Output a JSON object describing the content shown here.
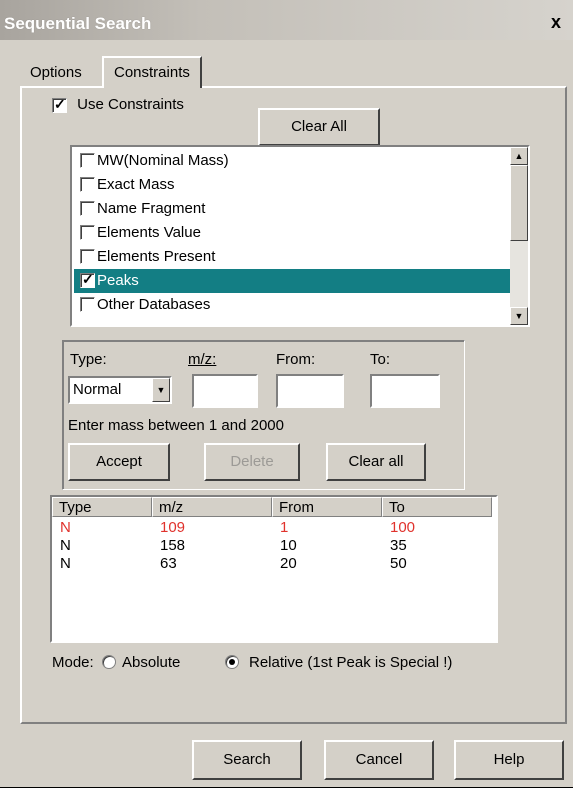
{
  "window": {
    "title": "Sequential Search",
    "close_label": "x"
  },
  "tabs": {
    "options": "Options",
    "constraints": "Constraints"
  },
  "use_constraints": {
    "label": "Use Constraints",
    "checked": true
  },
  "clear_all_top": "Clear All",
  "constraint_list": [
    {
      "label": "MW(Nominal Mass)",
      "checked": false,
      "selected": false
    },
    {
      "label": "Exact Mass",
      "checked": false,
      "selected": false
    },
    {
      "label": "Name Fragment",
      "checked": false,
      "selected": false
    },
    {
      "label": "Elements Value",
      "checked": false,
      "selected": false
    },
    {
      "label": "Elements Present",
      "checked": false,
      "selected": false
    },
    {
      "label": "Peaks",
      "checked": true,
      "selected": true
    },
    {
      "label": "Other Databases",
      "checked": false,
      "selected": false
    }
  ],
  "peak_form": {
    "type_label": "Type:",
    "mz_label": "m/z:",
    "from_label": "From:",
    "to_label": "To:",
    "type_value": "Normal",
    "mz_value": "",
    "from_value": "",
    "to_value": "",
    "hint": "Enter mass between 1 and 2000",
    "accept": "Accept",
    "delete": "Delete",
    "clear_all": "Clear all"
  },
  "peaks_table": {
    "columns": [
      "Type",
      "m/z",
      "From",
      "To"
    ],
    "rows": [
      {
        "type": "N",
        "mz": "109",
        "from": "1",
        "to": "100",
        "highlight": true
      },
      {
        "type": "N",
        "mz": "158",
        "from": "10",
        "to": "35",
        "highlight": false
      },
      {
        "type": "N",
        "mz": "63",
        "from": "20",
        "to": "50",
        "highlight": false
      }
    ]
  },
  "mode": {
    "label": "Mode:",
    "absolute": "Absolute",
    "relative": "Relative (1st Peak is Special !)",
    "selected": "relative"
  },
  "footer": {
    "search": "Search",
    "cancel": "Cancel",
    "help": "Help"
  },
  "colors": {
    "selection": "#137e84",
    "highlight_row": "#e0322c",
    "face": "#d4d0c8"
  }
}
